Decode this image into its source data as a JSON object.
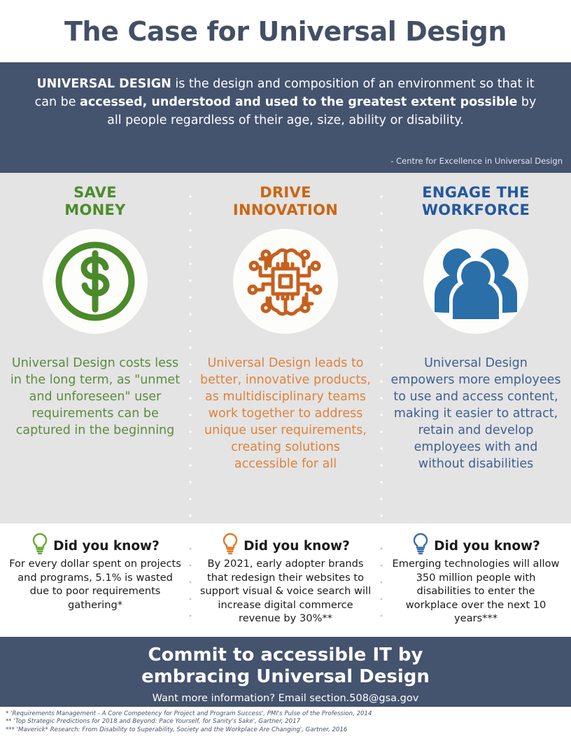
{
  "title": "The Case for Universal Design",
  "definition": {
    "lead": "UNIVERSAL DESIGN",
    "part1": " is the design and composition of an environment so that it can be ",
    "emph1": "accessed, understood and used to the greatest extent possible",
    "part2": " by all people regardless of their age, size, ability or disability.",
    "attribution": "- Centre for Excellence in Universal Design"
  },
  "columns": [
    {
      "heading": "SAVE\nMONEY",
      "heading_line1": "SAVE",
      "heading_line2": "MONEY",
      "icon": "dollar-circle-icon",
      "color": "#4c8c2b",
      "body": "Universal Design costs less in the long term, as \"unmet and unforeseen\" user requirements can be captured in the beginning"
    },
    {
      "heading_line1": "DRIVE",
      "heading_line2": "INNOVATION",
      "icon": "circuit-brain-icon",
      "color": "#cc6611",
      "body": "Universal Design leads to better, innovative products, as multidisciplinary teams work together to address unique user requirements, creating solutions accessible for all"
    },
    {
      "heading_line1": "ENGAGE THE",
      "heading_line2": "WORKFORCE",
      "icon": "people-group-icon",
      "color": "#23589e",
      "body": "Universal Design empowers more employees to use and access content, making it easier to attract, retain and develop employees with and without disabilities"
    }
  ],
  "did_you_know": [
    {
      "icon": "lightbulb-icon",
      "icon_color": "#6aaa3c",
      "title": "Did you know?",
      "body": "For every dollar spent on projects and programs, 5.1% is wasted due to poor requirements gathering*"
    },
    {
      "icon": "lightbulb-icon",
      "icon_color": "#e07c2a",
      "title": "Did you know?",
      "body": "By 2021, early adopter brands that redesign their websites to support visual & voice search will increase digital commerce revenue by 30%**"
    },
    {
      "icon": "lightbulb-icon",
      "icon_color": "#3f6fa8",
      "title": "Did you know?",
      "body": "Emerging technologies will allow 350 million people with disabilities to enter the workplace over the next 10 years***"
    }
  ],
  "cta": {
    "line1": "Commit to accessible IT by",
    "line2": "embracing Universal Design",
    "subtitle": "Want more information? Email section.508@gsa.gov"
  },
  "citations": [
    "* 'Requirements Management - A Core Competency for Project and Program Success', PMI's Pulse of the Profession, 2014",
    "** 'Top Strategic Predictions for 2018 and Beyond: Pace Yourself, for Sanity's Sake', Gartner, 2017",
    "*** 'Maverick* Research: From Disability to Superability, Society and the Workplace Are Changing', Gartner, 2016"
  ],
  "theme": {
    "dark_band": "#44536e",
    "gray_band": "#e4e4e4",
    "green": "#4c8c2b",
    "orange": "#cc6611",
    "blue": "#23589e"
  }
}
